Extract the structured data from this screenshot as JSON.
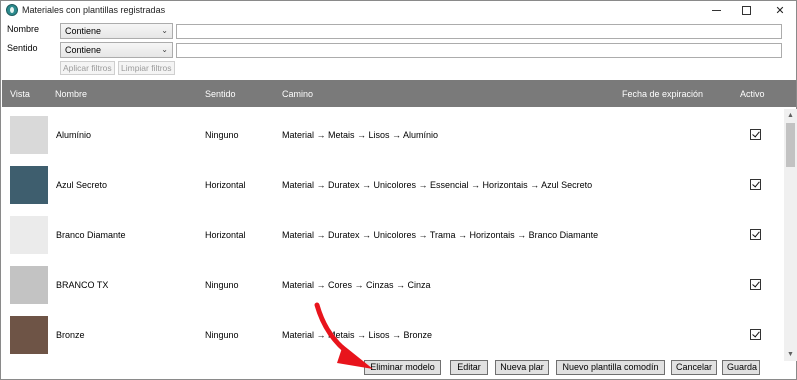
{
  "window": {
    "title": "Materiales con plantillas registradas"
  },
  "filters": {
    "nombre_label": "Nombre",
    "sentido_label": "Sentido",
    "nombre_mode": "Contiene",
    "sentido_mode": "Contiene",
    "nombre_value": "",
    "sentido_value": "",
    "apply_label": "Aplicar filtros",
    "clear_label": "Limpiar filtros"
  },
  "columns": {
    "vista": "Vista",
    "nombre": "Nombre",
    "sentido": "Sentido",
    "camino": "Camino",
    "fecha": "Fecha de expiración",
    "activo": "Activo"
  },
  "rows": [
    {
      "nombre": "Alumínio",
      "sentido": "Ninguno",
      "camino": "Material → Metais → Lisos → Alumínio",
      "activo": true,
      "color": "#d9d9d9"
    },
    {
      "nombre": "Azul Secreto",
      "sentido": "Horizontal",
      "camino": "Material → Duratex → Unicolores → Essencial → Horizontais → Azul Secreto",
      "activo": true,
      "color": "#3e5e6e"
    },
    {
      "nombre": "Branco Diamante",
      "sentido": "Horizontal",
      "camino": "Material → Duratex → Unicolores → Trama → Horizontais → Branco Diamante",
      "activo": true,
      "color": "#ebebeb"
    },
    {
      "nombre": "BRANCO TX",
      "sentido": "Ninguno",
      "camino": "Material → Cores → Cinzas → Cinza",
      "activo": true,
      "color": "#c3c3c3"
    },
    {
      "nombre": "Bronze",
      "sentido": "Ninguno",
      "camino": "Material → Metais → Lisos → Bronze",
      "activo": true,
      "color": "#6e5446"
    }
  ],
  "buttons": {
    "eliminar": "Eliminar modelo",
    "editar": "Editar",
    "nueva": "Nueva plar",
    "nueva_comodin": "Nuevo plantilla comodín",
    "cancelar": "Cancelar",
    "guardar": "Guarda"
  },
  "annotation": {
    "arrow_color": "#e8141c"
  }
}
